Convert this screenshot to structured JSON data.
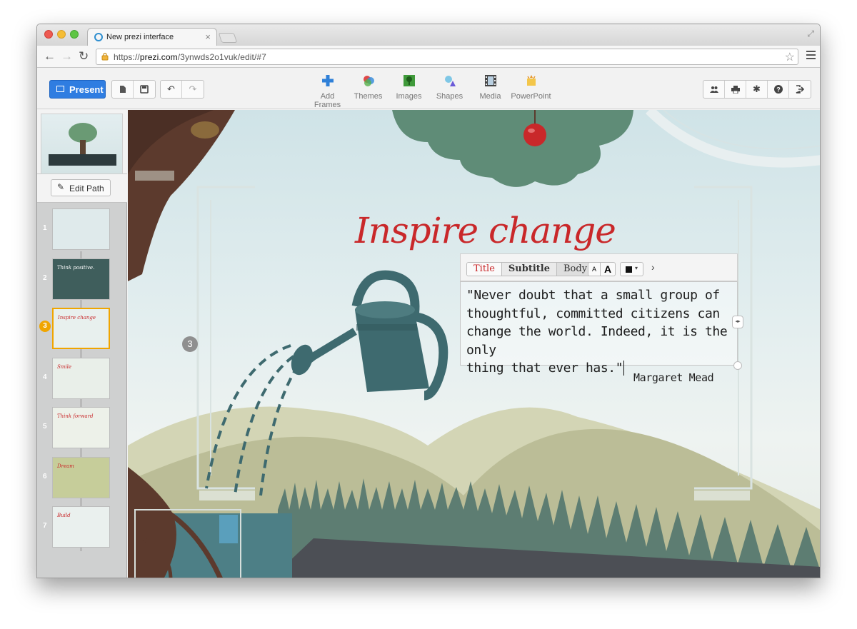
{
  "browser": {
    "tab_title": "New prezi interface",
    "url_prefix": "https://",
    "url_host": "prezi.com",
    "url_path": "/3ynwds2o1vuk/edit/#7"
  },
  "toolbar": {
    "present_label": "Present",
    "center_tools": [
      {
        "label": "Add Frames",
        "icon": "add-frames-icon",
        "color": "#2f80d8"
      },
      {
        "label": "Themes",
        "icon": "themes-icon",
        "color": "#e04848"
      },
      {
        "label": "Images",
        "icon": "images-icon",
        "color": "#3f9a3a"
      },
      {
        "label": "Shapes",
        "icon": "shapes-icon",
        "color": "#6a5bd8"
      },
      {
        "label": "Media",
        "icon": "media-icon",
        "color": "#444444"
      },
      {
        "label": "PowerPoint",
        "icon": "powerpoint-icon",
        "color": "#e8b92a"
      }
    ]
  },
  "sidebar": {
    "edit_path_label": "Edit Path",
    "active_slide": 3,
    "slides": [
      {
        "num": "1",
        "title": "",
        "bg": "#dfeaeb"
      },
      {
        "num": "2",
        "title": "Think positive.",
        "bg": "#3f5e5c"
      },
      {
        "num": "3",
        "title": "Inspire change",
        "bg": "#e8f0ee"
      },
      {
        "num": "4",
        "title": "Smile",
        "bg": "#e9efe9"
      },
      {
        "num": "5",
        "title": "Think forward",
        "bg": "#edf1e9"
      },
      {
        "num": "6",
        "title": "Dream",
        "bg": "#c6cd9a"
      },
      {
        "num": "7",
        "title": "Build",
        "bg": "#eaf0ee"
      }
    ]
  },
  "canvas": {
    "title": "Inspire change",
    "quote_line1": "\"Never doubt that a small group of",
    "quote_line2": "thoughtful, committed citizens can",
    "quote_line3": "change the world. Indeed, it is the only",
    "quote_line4": "thing that ever has.\"",
    "author": "Margaret Mead",
    "path_number": "3",
    "title_color": "#c9282a"
  },
  "text_toolbar": {
    "title_label": "Title",
    "subtitle_label": "Subtitle",
    "body_label": "Body",
    "font_small": "A",
    "font_large": "A",
    "more": "›"
  }
}
